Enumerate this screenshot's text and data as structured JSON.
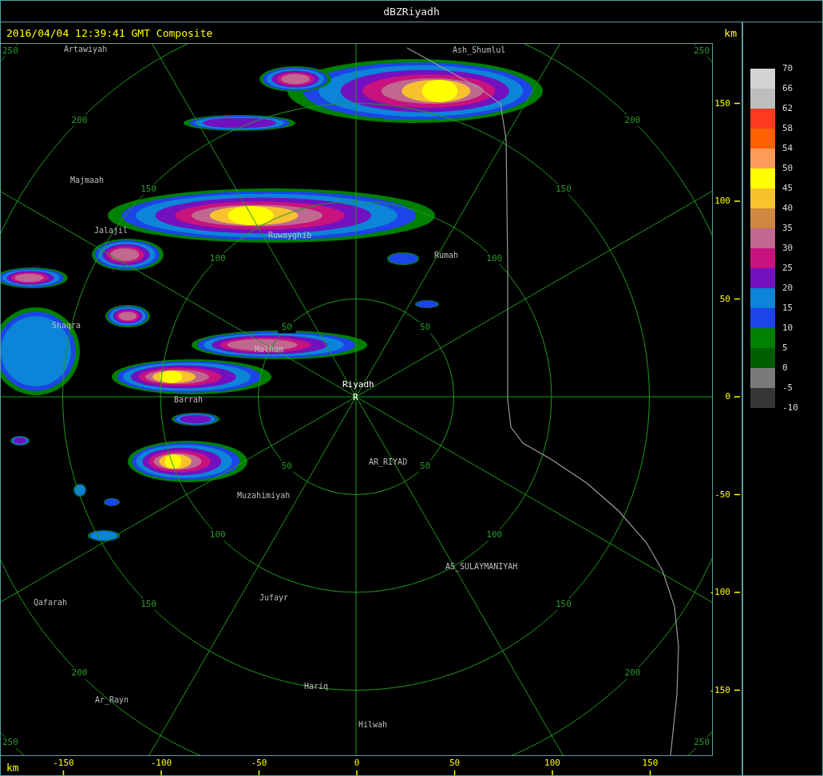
{
  "window": {
    "title": "dBZRiyadh"
  },
  "header": {
    "timestamp": "2016/04/04 12:39:41 GMT Composite",
    "unit": "km"
  },
  "map": {
    "places": [
      {
        "name": "Artawiyah",
        "kind": "city"
      },
      {
        "name": "Ash_Shumlul",
        "kind": "city"
      },
      {
        "name": "Majmaah",
        "kind": "city"
      },
      {
        "name": "Jalajil",
        "kind": "city"
      },
      {
        "name": "Ruwayghib",
        "kind": "city"
      },
      {
        "name": "Rumah",
        "kind": "city"
      },
      {
        "name": "Shaqra",
        "kind": "city"
      },
      {
        "name": "Malham",
        "kind": "city"
      },
      {
        "name": "Riyadh",
        "kind": "radar"
      },
      {
        "name": "R",
        "kind": "marker"
      },
      {
        "name": "Barrah",
        "kind": "city"
      },
      {
        "name": "AR_RIYAD",
        "kind": "city"
      },
      {
        "name": "Muzahimiyah",
        "kind": "city"
      },
      {
        "name": "AS_SULAYMANIYAH",
        "kind": "city"
      },
      {
        "name": "Jufayr",
        "kind": "city"
      },
      {
        "name": "Qafarah",
        "kind": "city"
      },
      {
        "name": "Hariq",
        "kind": "city"
      },
      {
        "name": "Ar_Rayn",
        "kind": "city"
      },
      {
        "name": "Hilwah",
        "kind": "city"
      }
    ],
    "range_labels": {
      "nw": [
        "50",
        "100",
        "150",
        "200",
        "250"
      ],
      "ne": [
        "50",
        "100",
        "150",
        "200",
        "250"
      ],
      "sw": [
        "50",
        "100",
        "150",
        "200",
        "250"
      ],
      "se": [
        "50",
        "100",
        "150",
        "200",
        "250"
      ]
    }
  },
  "y_axis": {
    "ticks": [
      "150",
      "100",
      "50",
      "0",
      "-50",
      "-100",
      "-150"
    ]
  },
  "x_axis": {
    "unit": "km",
    "ticks": [
      "-150",
      "-100",
      "-50",
      "0",
      "50",
      "100",
      "150"
    ]
  },
  "legend": {
    "bins": [
      {
        "label": "70",
        "color": "#d3d3d3"
      },
      {
        "label": "66",
        "color": "#bdbdbd"
      },
      {
        "label": "62",
        "color": "#ff3a20"
      },
      {
        "label": "58",
        "color": "#ff6000"
      },
      {
        "label": "54",
        "color": "#ff9a5a"
      },
      {
        "label": "50",
        "color": "#ffff00"
      },
      {
        "label": "45",
        "color": "#f8c22f"
      },
      {
        "label": "40",
        "color": "#d08840"
      },
      {
        "label": "35",
        "color": "#c06890"
      },
      {
        "label": "30",
        "color": "#c8127e"
      },
      {
        "label": "25",
        "color": "#7310c0"
      },
      {
        "label": "20",
        "color": "#0c84d8"
      },
      {
        "label": "15",
        "color": "#1c44e8"
      },
      {
        "label": "10",
        "color": "#008000"
      },
      {
        "label": "5",
        "color": "#005e00"
      },
      {
        "label": "0",
        "color": "#7a7a7a"
      },
      {
        "label": "-5",
        "color": "#363636"
      }
    ],
    "bottom_label": "-10"
  }
}
